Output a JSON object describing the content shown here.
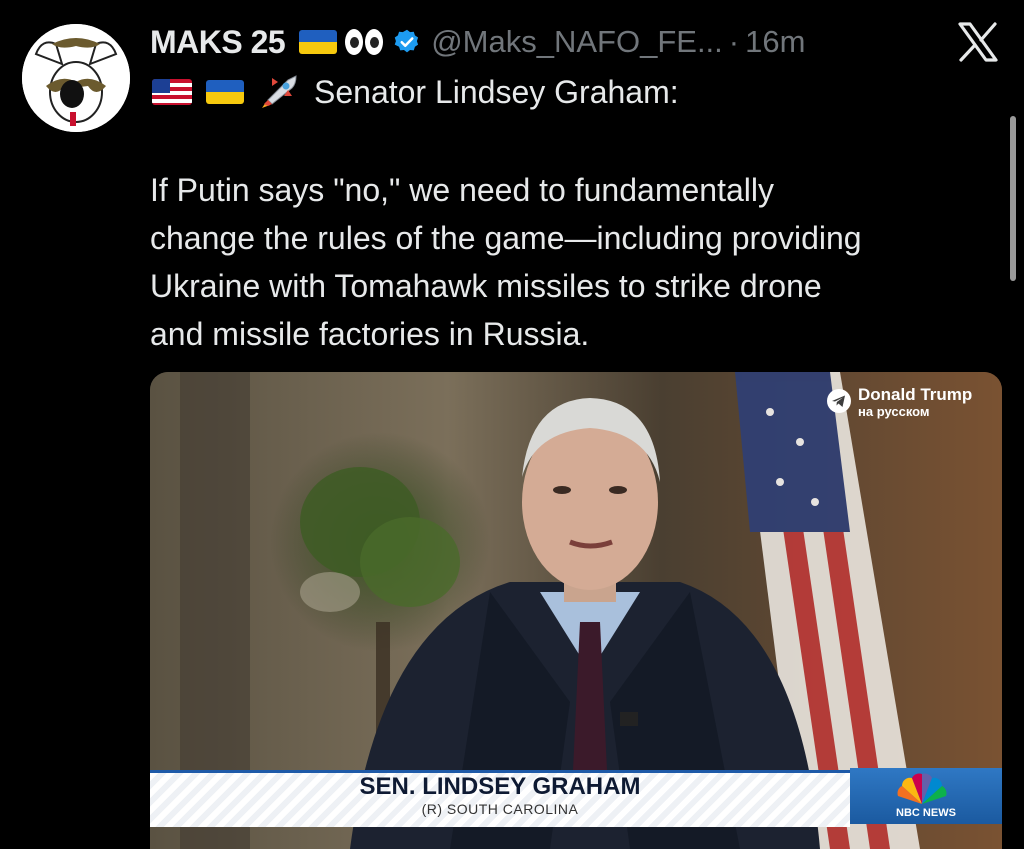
{
  "tweet": {
    "author": {
      "display_name": "MAKS 25",
      "handle": "@Maks_NAFO_FE...",
      "separator": "·",
      "time": "16m",
      "verified": true
    },
    "emoji_icons": [
      "flag-ukraine-icon",
      "eyes-icon",
      "flag-us-icon",
      "flag-ukraine-icon",
      "rocket-icon"
    ],
    "subline_text": "Senator Lindsey Graham:",
    "body_lines": [
      "If Putin says \"no,\" we need to fundamentally",
      "change the rules of the game—including providing",
      "Ukraine with Tomahawk missiles to strike drone",
      "and missile factories in Russia."
    ]
  },
  "media": {
    "watermark_title": "Donald Trump",
    "watermark_subtitle": "на русском",
    "lower_third_name": "SEN. LINDSEY GRAHAM",
    "lower_third_subtitle": "(R) SOUTH CAROLINA",
    "network_label": "NBC NEWS"
  },
  "colors": {
    "background": "#000000",
    "text_primary": "#e7e9ea",
    "text_secondary": "#71767b",
    "verified_blue": "#1d9bf0",
    "nbc_blue": "#1e5aa8"
  }
}
